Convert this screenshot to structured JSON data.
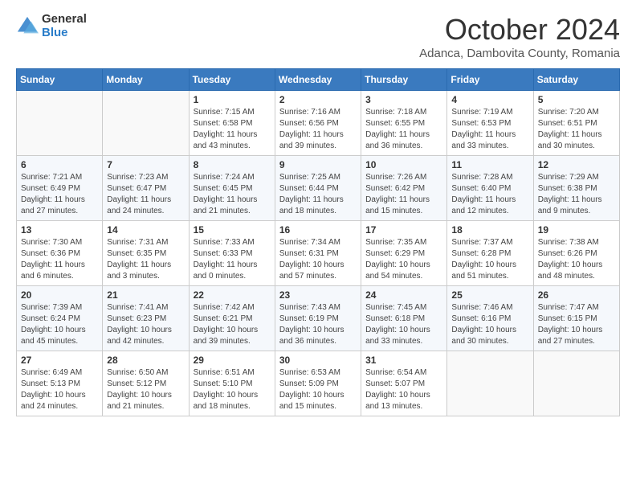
{
  "logo": {
    "general": "General",
    "blue": "Blue"
  },
  "title": {
    "month": "October 2024",
    "location": "Adanca, Dambovita County, Romania"
  },
  "headers": [
    "Sunday",
    "Monday",
    "Tuesday",
    "Wednesday",
    "Thursday",
    "Friday",
    "Saturday"
  ],
  "weeks": [
    [
      {
        "day": "",
        "sunrise": "",
        "sunset": "",
        "daylight": ""
      },
      {
        "day": "",
        "sunrise": "",
        "sunset": "",
        "daylight": ""
      },
      {
        "day": "1",
        "sunrise": "Sunrise: 7:15 AM",
        "sunset": "Sunset: 6:58 PM",
        "daylight": "Daylight: 11 hours and 43 minutes."
      },
      {
        "day": "2",
        "sunrise": "Sunrise: 7:16 AM",
        "sunset": "Sunset: 6:56 PM",
        "daylight": "Daylight: 11 hours and 39 minutes."
      },
      {
        "day": "3",
        "sunrise": "Sunrise: 7:18 AM",
        "sunset": "Sunset: 6:55 PM",
        "daylight": "Daylight: 11 hours and 36 minutes."
      },
      {
        "day": "4",
        "sunrise": "Sunrise: 7:19 AM",
        "sunset": "Sunset: 6:53 PM",
        "daylight": "Daylight: 11 hours and 33 minutes."
      },
      {
        "day": "5",
        "sunrise": "Sunrise: 7:20 AM",
        "sunset": "Sunset: 6:51 PM",
        "daylight": "Daylight: 11 hours and 30 minutes."
      }
    ],
    [
      {
        "day": "6",
        "sunrise": "Sunrise: 7:21 AM",
        "sunset": "Sunset: 6:49 PM",
        "daylight": "Daylight: 11 hours and 27 minutes."
      },
      {
        "day": "7",
        "sunrise": "Sunrise: 7:23 AM",
        "sunset": "Sunset: 6:47 PM",
        "daylight": "Daylight: 11 hours and 24 minutes."
      },
      {
        "day": "8",
        "sunrise": "Sunrise: 7:24 AM",
        "sunset": "Sunset: 6:45 PM",
        "daylight": "Daylight: 11 hours and 21 minutes."
      },
      {
        "day": "9",
        "sunrise": "Sunrise: 7:25 AM",
        "sunset": "Sunset: 6:44 PM",
        "daylight": "Daylight: 11 hours and 18 minutes."
      },
      {
        "day": "10",
        "sunrise": "Sunrise: 7:26 AM",
        "sunset": "Sunset: 6:42 PM",
        "daylight": "Daylight: 11 hours and 15 minutes."
      },
      {
        "day": "11",
        "sunrise": "Sunrise: 7:28 AM",
        "sunset": "Sunset: 6:40 PM",
        "daylight": "Daylight: 11 hours and 12 minutes."
      },
      {
        "day": "12",
        "sunrise": "Sunrise: 7:29 AM",
        "sunset": "Sunset: 6:38 PM",
        "daylight": "Daylight: 11 hours and 9 minutes."
      }
    ],
    [
      {
        "day": "13",
        "sunrise": "Sunrise: 7:30 AM",
        "sunset": "Sunset: 6:36 PM",
        "daylight": "Daylight: 11 hours and 6 minutes."
      },
      {
        "day": "14",
        "sunrise": "Sunrise: 7:31 AM",
        "sunset": "Sunset: 6:35 PM",
        "daylight": "Daylight: 11 hours and 3 minutes."
      },
      {
        "day": "15",
        "sunrise": "Sunrise: 7:33 AM",
        "sunset": "Sunset: 6:33 PM",
        "daylight": "Daylight: 11 hours and 0 minutes."
      },
      {
        "day": "16",
        "sunrise": "Sunrise: 7:34 AM",
        "sunset": "Sunset: 6:31 PM",
        "daylight": "Daylight: 10 hours and 57 minutes."
      },
      {
        "day": "17",
        "sunrise": "Sunrise: 7:35 AM",
        "sunset": "Sunset: 6:29 PM",
        "daylight": "Daylight: 10 hours and 54 minutes."
      },
      {
        "day": "18",
        "sunrise": "Sunrise: 7:37 AM",
        "sunset": "Sunset: 6:28 PM",
        "daylight": "Daylight: 10 hours and 51 minutes."
      },
      {
        "day": "19",
        "sunrise": "Sunrise: 7:38 AM",
        "sunset": "Sunset: 6:26 PM",
        "daylight": "Daylight: 10 hours and 48 minutes."
      }
    ],
    [
      {
        "day": "20",
        "sunrise": "Sunrise: 7:39 AM",
        "sunset": "Sunset: 6:24 PM",
        "daylight": "Daylight: 10 hours and 45 minutes."
      },
      {
        "day": "21",
        "sunrise": "Sunrise: 7:41 AM",
        "sunset": "Sunset: 6:23 PM",
        "daylight": "Daylight: 10 hours and 42 minutes."
      },
      {
        "day": "22",
        "sunrise": "Sunrise: 7:42 AM",
        "sunset": "Sunset: 6:21 PM",
        "daylight": "Daylight: 10 hours and 39 minutes."
      },
      {
        "day": "23",
        "sunrise": "Sunrise: 7:43 AM",
        "sunset": "Sunset: 6:19 PM",
        "daylight": "Daylight: 10 hours and 36 minutes."
      },
      {
        "day": "24",
        "sunrise": "Sunrise: 7:45 AM",
        "sunset": "Sunset: 6:18 PM",
        "daylight": "Daylight: 10 hours and 33 minutes."
      },
      {
        "day": "25",
        "sunrise": "Sunrise: 7:46 AM",
        "sunset": "Sunset: 6:16 PM",
        "daylight": "Daylight: 10 hours and 30 minutes."
      },
      {
        "day": "26",
        "sunrise": "Sunrise: 7:47 AM",
        "sunset": "Sunset: 6:15 PM",
        "daylight": "Daylight: 10 hours and 27 minutes."
      }
    ],
    [
      {
        "day": "27",
        "sunrise": "Sunrise: 6:49 AM",
        "sunset": "Sunset: 5:13 PM",
        "daylight": "Daylight: 10 hours and 24 minutes."
      },
      {
        "day": "28",
        "sunrise": "Sunrise: 6:50 AM",
        "sunset": "Sunset: 5:12 PM",
        "daylight": "Daylight: 10 hours and 21 minutes."
      },
      {
        "day": "29",
        "sunrise": "Sunrise: 6:51 AM",
        "sunset": "Sunset: 5:10 PM",
        "daylight": "Daylight: 10 hours and 18 minutes."
      },
      {
        "day": "30",
        "sunrise": "Sunrise: 6:53 AM",
        "sunset": "Sunset: 5:09 PM",
        "daylight": "Daylight: 10 hours and 15 minutes."
      },
      {
        "day": "31",
        "sunrise": "Sunrise: 6:54 AM",
        "sunset": "Sunset: 5:07 PM",
        "daylight": "Daylight: 10 hours and 13 minutes."
      },
      {
        "day": "",
        "sunrise": "",
        "sunset": "",
        "daylight": ""
      },
      {
        "day": "",
        "sunrise": "",
        "sunset": "",
        "daylight": ""
      }
    ]
  ]
}
